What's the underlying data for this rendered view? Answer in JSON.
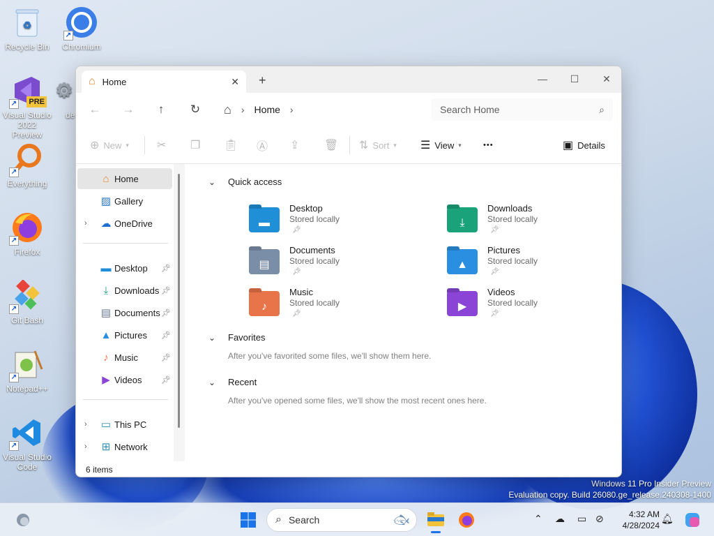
{
  "desktop": {
    "icons": [
      {
        "label": "Recycle Bin",
        "icon": "recycle-bin-icon"
      },
      {
        "label": "Chromium",
        "icon": "chromium-icon"
      },
      {
        "label": "Visual Studio 2022 Preview",
        "icon": "visual-studio-icon",
        "badge": "PRE"
      },
      {
        "label": "de",
        "icon": "partial-icon"
      },
      {
        "label": "Everything",
        "icon": "everything-icon"
      },
      {
        "label": "Firefox",
        "icon": "firefox-icon"
      },
      {
        "label": "Git Bash",
        "icon": "git-bash-icon"
      },
      {
        "label": "Notepad++",
        "icon": "notepad-plus-plus-icon"
      },
      {
        "label": "Visual Studio Code",
        "icon": "vscode-icon"
      }
    ],
    "watermark": {
      "line1": "Windows 11 Pro Insider Preview",
      "line2": "Evaluation copy. Build 26080.ge_release.240308-1400"
    }
  },
  "window": {
    "tab": {
      "label": "Home",
      "close": "✕"
    },
    "new_tab": "+",
    "controls": {
      "minimize": "—",
      "maximize": "☐",
      "close": "✕"
    },
    "nav": {
      "back": "←",
      "forward": "→",
      "up": "↑",
      "refresh": "↻"
    },
    "address": {
      "home_glyph": "⌂",
      "sep": "›",
      "location": "Home",
      "sep2": "›"
    },
    "search": {
      "placeholder": "Search Home"
    },
    "commands": {
      "new": "New",
      "sort": "Sort",
      "view": "View",
      "more": "•••",
      "details": "Details"
    },
    "sidebar": {
      "top": [
        {
          "label": "Home",
          "selected": true
        },
        {
          "label": "Gallery"
        },
        {
          "label": "OneDrive",
          "expandable": true
        }
      ],
      "pinned": [
        {
          "label": "Desktop"
        },
        {
          "label": "Downloads"
        },
        {
          "label": "Documents"
        },
        {
          "label": "Pictures"
        },
        {
          "label": "Music"
        },
        {
          "label": "Videos"
        }
      ],
      "bottom": [
        {
          "label": "This PC"
        },
        {
          "label": "Network"
        }
      ]
    },
    "sections": {
      "quick_access": "Quick access",
      "favorites": "Favorites",
      "favorites_note": "After you've favorited some files, we'll show them here.",
      "recent": "Recent",
      "recent_note": "After you've opened some files, we'll show the most recent ones here."
    },
    "quick_access": [
      {
        "name": "Desktop",
        "status": "Stored locally",
        "color": "#1f8fd8"
      },
      {
        "name": "Downloads",
        "status": "Stored locally",
        "color": "#1aa37a"
      },
      {
        "name": "Documents",
        "status": "Stored locally",
        "color": "#7b8ea8"
      },
      {
        "name": "Pictures",
        "status": "Stored locally",
        "color": "#2a8fe0"
      },
      {
        "name": "Music",
        "status": "Stored locally",
        "color": "#e8744a"
      },
      {
        "name": "Videos",
        "status": "Stored locally",
        "color": "#8a45d6"
      }
    ],
    "status": "6 items"
  },
  "taskbar": {
    "search_label": "Search",
    "clock": {
      "time": "4:32 AM",
      "date": "4/28/2024"
    }
  }
}
